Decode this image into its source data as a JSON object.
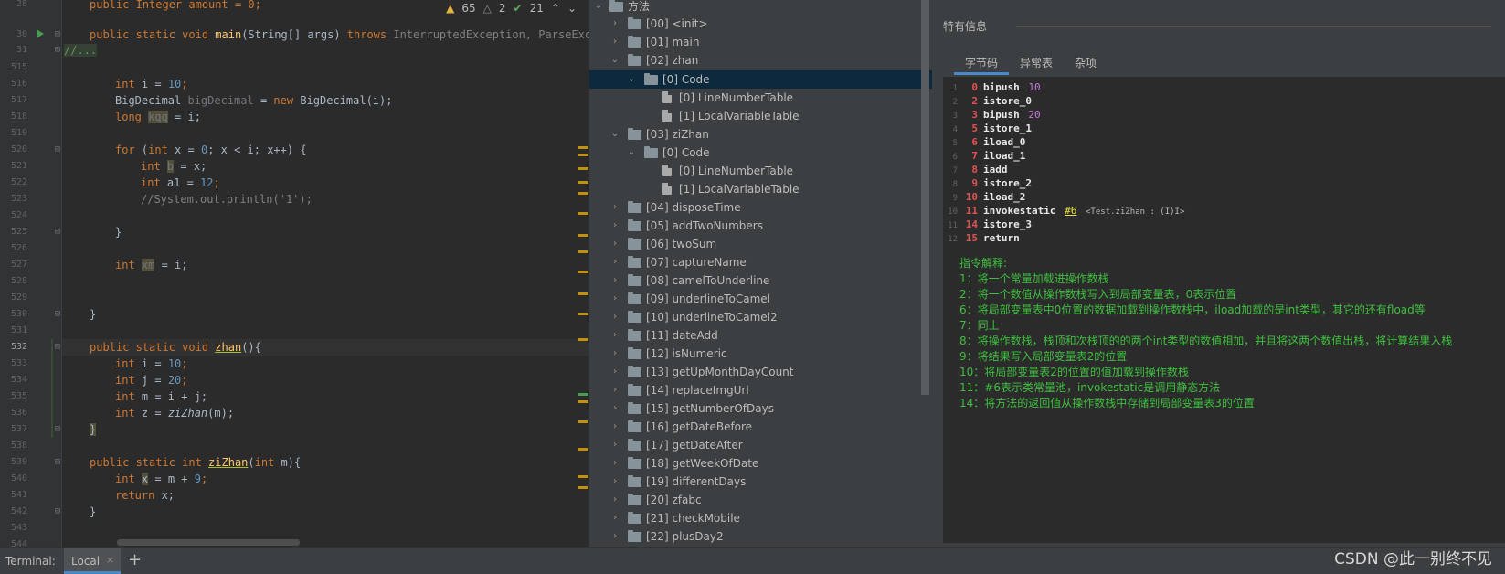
{
  "editor": {
    "line_numbers": [
      "28",
      "30",
      "31",
      "",
      "515",
      "516",
      "517",
      "518",
      "519",
      "520",
      "521",
      "522",
      "523",
      "524",
      "525",
      "526",
      "527",
      "528",
      "529",
      "530",
      "531",
      "532",
      "533",
      "534",
      "535",
      "536",
      "537",
      "538",
      "539",
      "540",
      "541",
      "542",
      "543",
      "544"
    ],
    "inspections": {
      "warnings": "65",
      "weak_warnings": "2",
      "ok": "21"
    },
    "lines": {
      "l28": "public Integer amount = 0;",
      "l30_kw": "public static void ",
      "l30_fn": "main",
      "l30_args": "(String[] args) ",
      "l30_throws": "throws ",
      "l30_ex": "InterruptedException, ParseExcep",
      "l31": "//...",
      "l516_kw": "int ",
      "l516_rest": "i = ",
      "l516_num": "10",
      "l517_type": "BigDecimal ",
      "l517_var": "bigDecimal",
      "l517_eq": " = ",
      "l517_new": "new ",
      "l517_rest": "BigDecimal(i);",
      "l518_kw": "long ",
      "l518_var": "kqq",
      "l518_rest": " = i;",
      "l520_kw": "for ",
      "l520_a": "(",
      "l520_int": "int ",
      "l520_b": "x = ",
      "l520_zero": "0",
      "l520_c": "; x < i; x++) {",
      "l521_kw": "int ",
      "l521_var": "b",
      "l521_rest": " = x;",
      "l522_kw": "int ",
      "l522_rest": "a1 = ",
      "l522_num": "12",
      "l523": "//System.out.println('1');",
      "l525": "}",
      "l527_kw": "int ",
      "l527_var": "xm",
      "l527_rest": " = i;",
      "l530": "}",
      "l532_kw": "public static void ",
      "l532_fn": "zhan",
      "l532_rest": "(){",
      "l533_kw": "int ",
      "l533_rest": "i = ",
      "l533_num": "10",
      "l534_kw": "int ",
      "l534_rest": "j = ",
      "l534_num": "20",
      "l535_kw": "int ",
      "l535_rest": "m = i + j;",
      "l536_kw": "int ",
      "l536_a": "z = ",
      "l536_call": "ziZhan",
      "l536_b": "(m);",
      "l537": "}",
      "l539_kw": "public static int ",
      "l539_fn": "ziZhan",
      "l539_a": "(",
      "l539_int": "int ",
      "l539_b": "m){",
      "l540_kw": "int ",
      "l540_var": "x",
      "l540_rest": " = m + ",
      "l540_num": "9",
      "l541_kw": "return ",
      "l541_rest": "x;",
      "l542": "}"
    }
  },
  "tree": {
    "root": "方法",
    "nodes": [
      "[00] <init>",
      "[01] main",
      "[02] zhan",
      "[0] Code",
      "[0] LineNumberTable",
      "[1] LocalVariableTable",
      "[03] ziZhan",
      "[0] Code",
      "[0] LineNumberTable",
      "[1] LocalVariableTable",
      "[04] disposeTime",
      "[05] addTwoNumbers",
      "[06] twoSum",
      "[07] captureName",
      "[08] camelToUnderline",
      "[09] underlineToCamel",
      "[10] underlineToCamel2",
      "[11] dateAdd",
      "[12] isNumeric",
      "[13] getUpMonthDayCount",
      "[14] replaceImgUrl",
      "[15] getNumberOfDays",
      "[16] getDateBefore",
      "[17] getDateAfter",
      "[18] getWeekOfDate",
      "[19] differentDays",
      "[20] zfabc",
      "[21] checkMobile",
      "[22] plusDay2"
    ]
  },
  "info": {
    "title": "特有信息",
    "tabs": [
      "字节码",
      "异常表",
      "杂项"
    ],
    "bytecode": [
      {
        "n": "1",
        "off": "0",
        "op": "bipush",
        "arg": "10"
      },
      {
        "n": "2",
        "off": "2",
        "op": "istore_0",
        "arg": ""
      },
      {
        "n": "3",
        "off": "3",
        "op": "bipush",
        "arg": "20"
      },
      {
        "n": "4",
        "off": "5",
        "op": "istore_1",
        "arg": ""
      },
      {
        "n": "5",
        "off": "6",
        "op": "iload_0",
        "arg": ""
      },
      {
        "n": "6",
        "off": "7",
        "op": "iload_1",
        "arg": ""
      },
      {
        "n": "7",
        "off": "8",
        "op": "iadd",
        "arg": ""
      },
      {
        "n": "8",
        "off": "9",
        "op": "istore_2",
        "arg": ""
      },
      {
        "n": "9",
        "off": "10",
        "op": "iload_2",
        "arg": ""
      },
      {
        "n": "10",
        "off": "11",
        "op": "invokestatic",
        "ref": "#6",
        "comment": "<Test.ziZhan : (I)I>"
      },
      {
        "n": "11",
        "off": "14",
        "op": "istore_3",
        "arg": ""
      },
      {
        "n": "12",
        "off": "15",
        "op": "return",
        "arg": ""
      }
    ],
    "explanations": [
      "指令解释:",
      "1：将一个常量加载进操作数栈",
      "2：将一个数值从操作数栈写入到局部变量表，0表示位置",
      "6：将局部变量表中0位置的数据加载到操作数栈中，iload加载的是int类型，其它的还有fload等",
      "7：同上",
      "8：将操作数栈，栈顶和次栈顶的的两个int类型的数值相加，并且将这两个数值出栈，将计算结果入栈",
      "9：将结果写入局部变量表2的位置",
      "10：将局部变量表2的位置的值加载到操作数栈",
      "11：#6表示类常量池，invokestatic是调用静态方法",
      "14：将方法的返回值从操作数栈中存储到局部变量表3的位置"
    ]
  },
  "bottom": {
    "terminal_label": "Terminal:",
    "tab_label": "Local",
    "close": "×",
    "add": "+"
  },
  "watermark": "CSDN @此一别终不见",
  "colors": {
    "keyword": "#cc7832",
    "number": "#6897bb",
    "method": "#ffc66d",
    "explain": "#3fbf3f",
    "offset": "#e05252",
    "accent": "#4a88c7"
  }
}
